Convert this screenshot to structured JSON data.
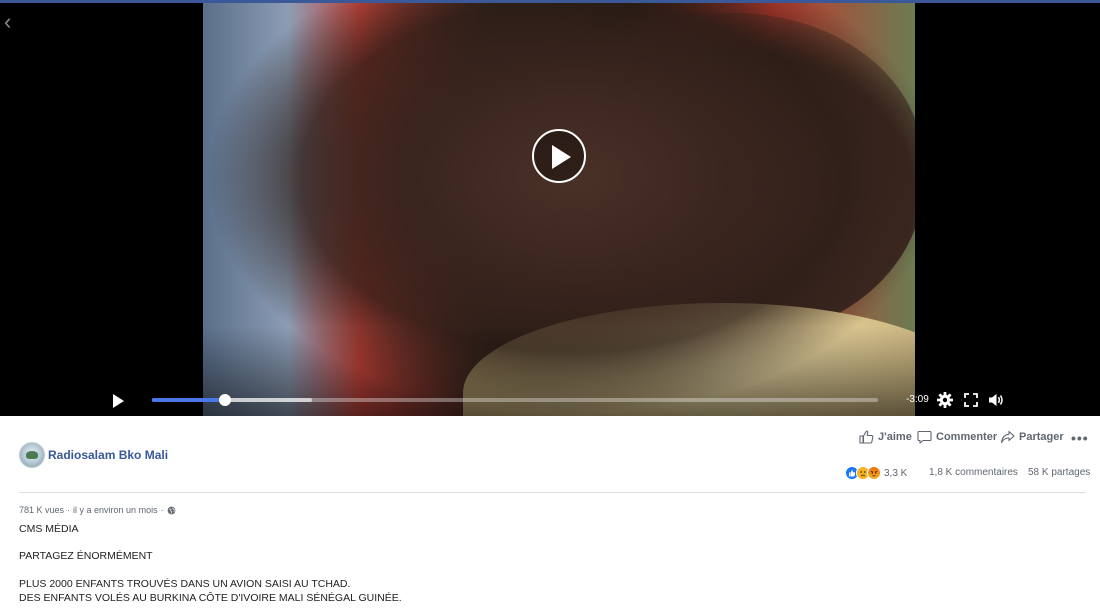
{
  "video": {
    "time_remaining": "-3:09",
    "played_fraction": 0.1,
    "buffered_fraction": 0.22
  },
  "post": {
    "page_name": "Radiosalam Bko Mali",
    "actions": {
      "like": "J'aime",
      "comment": "Commenter",
      "share": "Partager"
    },
    "reaction_count": "3,3 K",
    "comments_count": "1,8 K commentaires",
    "shares_count": "58 K partages",
    "views": "781 K vues",
    "posted": "il y a environ un mois",
    "description": [
      "CMS MÉDIA",
      "PARTAGEZ ÉNORMÉMENT",
      "PLUS 2000 ENFANTS TROUVÉS DANS UN AVION SAISI AU TCHAD.",
      "DES ENFANTS VOLÉS AU BURKINA CÔTE D'IVOIRE MALI SÉNÉGAL GUINÉE."
    ]
  },
  "colors": {
    "accent": "#4a76e8",
    "link": "#385898",
    "text_secondary": "#606770"
  },
  "icons": [
    "back-chevron-icon",
    "play-icon",
    "settings-icon",
    "fullscreen-icon",
    "volume-icon",
    "like-icon",
    "comment-icon",
    "share-icon",
    "more-icon",
    "globe-icon"
  ]
}
